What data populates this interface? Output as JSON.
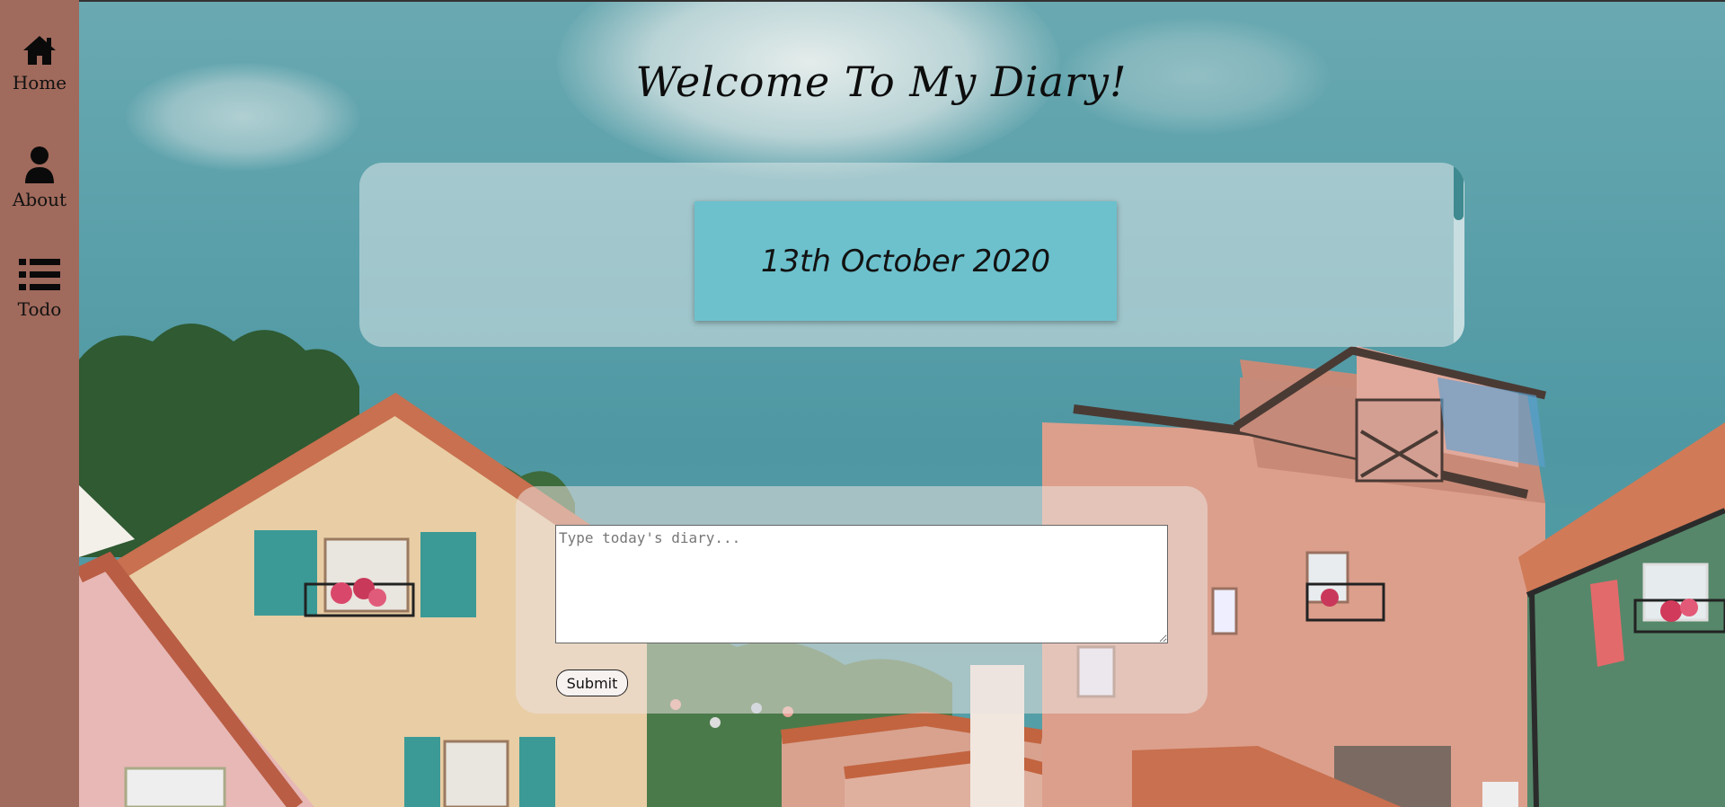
{
  "sidebar": {
    "items": [
      {
        "label": "Home",
        "icon": "home-icon"
      },
      {
        "label": "About",
        "icon": "user-icon"
      },
      {
        "label": "Todo",
        "icon": "list-icon"
      }
    ]
  },
  "main": {
    "title": "Welcome To My Diary!",
    "entries": [
      {
        "date": "13th October 2020"
      }
    ],
    "form": {
      "placeholder": "Type today's diary...",
      "value": "",
      "submit_label": "Submit"
    }
  },
  "colors": {
    "sidebar_bg": "#a06a5c",
    "entry_card_bg": "#6cc1cd",
    "scroll_thumb": "#3e8a90"
  }
}
